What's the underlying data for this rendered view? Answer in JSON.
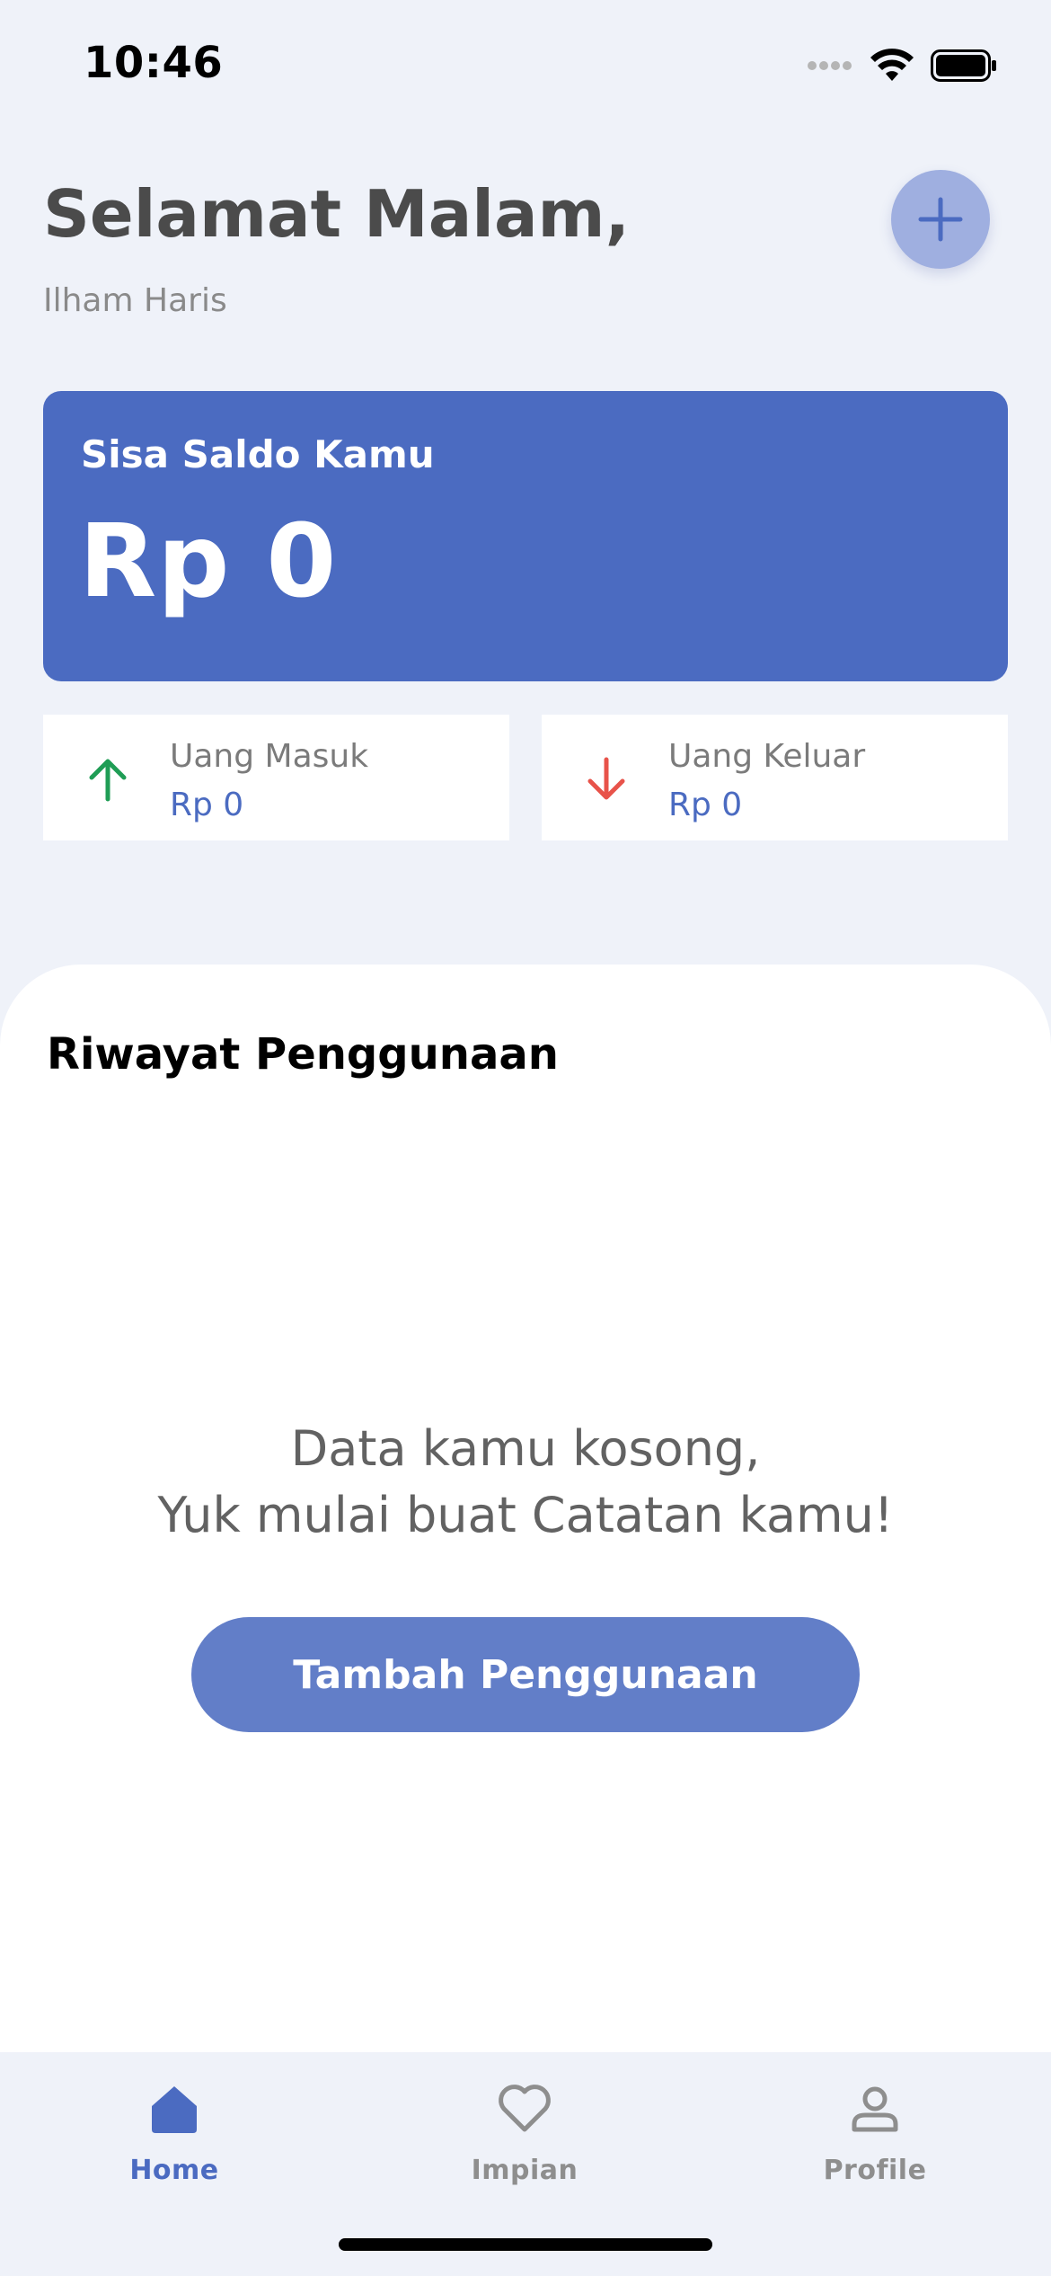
{
  "status_bar": {
    "time": "10:46",
    "icons": [
      "signal-icon",
      "wifi-icon",
      "battery-icon"
    ]
  },
  "header": {
    "greeting": "Selamat Malam,",
    "user_name": "Ilham Haris",
    "add_icon": "plus-icon"
  },
  "balance": {
    "label": "Sisa Saldo Kamu",
    "value": "Rp 0"
  },
  "summary": {
    "income": {
      "label": "Uang Masuk",
      "value": "Rp 0",
      "icon": "arrow-up-icon",
      "icon_color": "#1f9d55"
    },
    "expense": {
      "label": "Uang Keluar",
      "value": "Rp 0",
      "icon": "arrow-down-icon",
      "icon_color": "#e8534a"
    }
  },
  "history": {
    "title": "Riwayat Penggunaan",
    "empty_line1": "Data kamu kosong,",
    "empty_line2": "Yuk mulai buat Catatan kamu!",
    "button_label": "Tambah Penggunaan"
  },
  "nav": {
    "items": [
      {
        "label": "Home",
        "icon": "home-icon",
        "active": true
      },
      {
        "label": "Impian",
        "icon": "heart-icon",
        "active": false
      },
      {
        "label": "Profile",
        "icon": "person-icon",
        "active": false
      }
    ]
  },
  "colors": {
    "accent": "#4b6bc1",
    "button": "#627ec8",
    "fab": "#9fafe0",
    "background": "#eff2f9"
  }
}
